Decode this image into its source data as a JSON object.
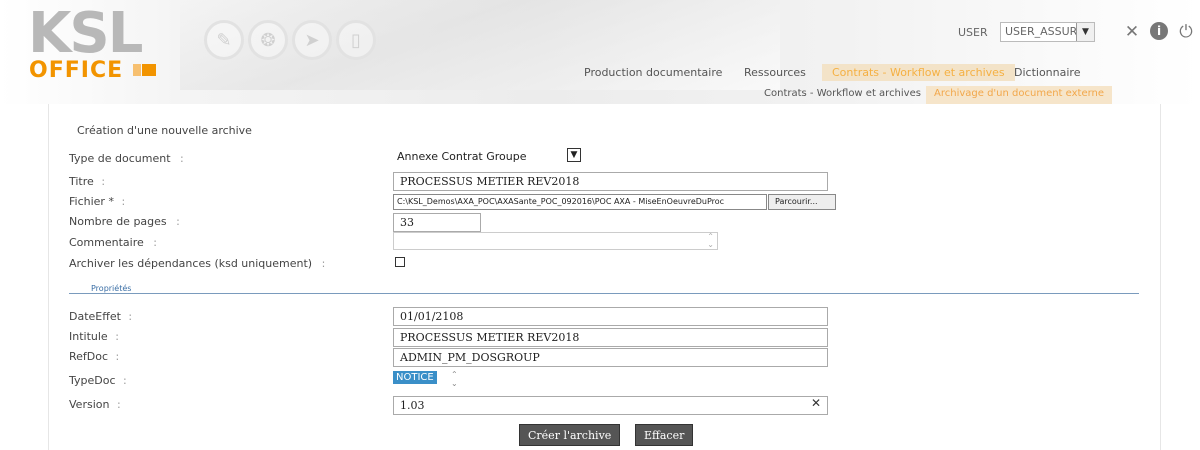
{
  "header": {
    "logo_top": "KSL",
    "logo_bottom": "OFFICE",
    "user_label": "USER",
    "user_value": "USER_ASSURA",
    "icons": [
      "edit-icon",
      "palette-icon",
      "send-icon",
      "document-icon",
      "tools-icon",
      "info-icon",
      "power-icon"
    ],
    "nav": [
      {
        "label": "Production documentaire"
      },
      {
        "label": "Ressources"
      },
      {
        "label": "Contrats - Workflow et archives",
        "active": true
      },
      {
        "label": "Dictionnaire"
      }
    ],
    "subnav": [
      {
        "label": "Contrats - Workflow et archives"
      },
      {
        "label": "Archivage d'un document externe",
        "active": true
      }
    ],
    "accent_color": "#f29400"
  },
  "form": {
    "title": "Création d'une nouvelle archive",
    "type_label": "Type de document",
    "type_value": "Annexe Contrat Groupe",
    "titre_label": "Titre",
    "titre_value": "PROCESSUS METIER REV2018",
    "fichier_label": "Fichier *",
    "fichier_value": "C:\\KSL_Demos\\AXA_POC\\AXASante_POC_092016\\POC AXA - MiseEnOeuvreDuProc",
    "browse_label": "Parcourir...",
    "pages_label": "Nombre de pages",
    "pages_value": "33",
    "commentaire_label": "Commentaire",
    "commentaire_value": "",
    "dependances_label": "Archiver les dépendances (ksd uniquement)",
    "dependances_checked": false,
    "section_label": "Propriétés",
    "date_label": "DateEffet",
    "date_value": "01/01/2108",
    "intitule_label": "Intitule",
    "intitule_value": "PROCESSUS METIER REV2018",
    "refdoc_label": "RefDoc",
    "refdoc_value": "ADMIN_PM_DOSGROUP",
    "typedoc_label": "TypeDoc",
    "typedoc_value": "NOTICE",
    "version_label": "Version",
    "version_value": "1.03",
    "create_button": "Créer l'archive",
    "clear_button": "Effacer",
    "colon": ":"
  }
}
